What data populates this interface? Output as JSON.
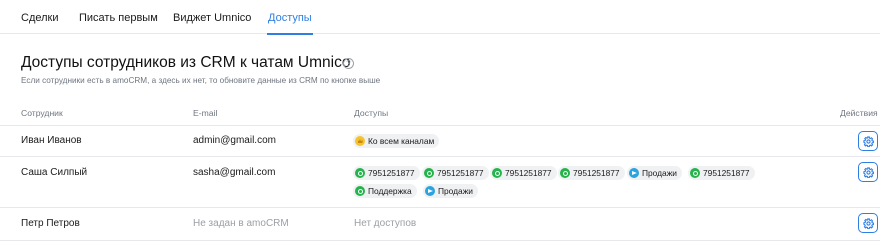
{
  "tabs": [
    {
      "label": "Сделки",
      "active": false
    },
    {
      "label": "Писать первым",
      "active": false
    },
    {
      "label": "Виджет Umnico",
      "active": false
    },
    {
      "label": "Доступы",
      "active": true
    }
  ],
  "section": {
    "title": "Доступы сотрудников из CRM к чатам Umnico",
    "help_icon": "?",
    "subtitle": "Если сотрудники есть в amoCRM, а здесь их нет, то обновите данные из CRM по кнопке выше"
  },
  "table": {
    "columns": [
      "Сотрудник",
      "E-mail",
      "Доступы",
      "Действия"
    ],
    "rows": [
      {
        "name": "Иван Иванов",
        "email": "admin@gmail.com",
        "email_muted": false,
        "access": [
          {
            "icon": "crown",
            "label": "Ко всем каналам"
          }
        ],
        "access_empty": ""
      },
      {
        "name": "Саша Силпый",
        "email": "sasha@gmail.com",
        "email_muted": false,
        "access": [
          {
            "icon": "whatsapp",
            "label": "7951251877"
          },
          {
            "icon": "whatsapp",
            "label": "7951251877"
          },
          {
            "icon": "whatsapp",
            "label": "7951251877"
          },
          {
            "icon": "whatsapp",
            "label": "7951251877"
          },
          {
            "icon": "telegram",
            "label": "Продажи"
          },
          {
            "icon": "whatsapp",
            "label": "7951251877"
          },
          {
            "icon": "whatsapp",
            "label": "Поддержка"
          },
          {
            "icon": "telegram",
            "label": "Продажи"
          }
        ],
        "access_empty": ""
      },
      {
        "name": "Петр Петров",
        "email": "Не задан в amoCRM",
        "email_muted": true,
        "access": [],
        "access_empty": "Нет доступов"
      }
    ]
  },
  "colors": {
    "accent": "#2f7fe3",
    "whatsapp": "#25b34b",
    "telegram": "#2aa3df",
    "crown": "#f4c430"
  }
}
